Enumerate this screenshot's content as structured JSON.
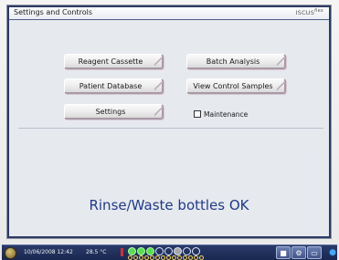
{
  "window": {
    "title": "Settings and Controls",
    "brand": "ISCUS",
    "brand_sup": "flex"
  },
  "buttons": {
    "reagent_cassette": "Reagent Cassette",
    "batch_analysis": "Batch Analysis",
    "patient_database": "Patient Database",
    "view_control_samples": "View Control Samples",
    "settings": "Settings"
  },
  "maintenance": {
    "label": "Maintenance",
    "checked": false
  },
  "status_message": "Rinse/Waste bottles OK",
  "taskbar": {
    "datetime": "10/06/2008 12:42",
    "temperature": "28.5 °C",
    "indicator_states": [
      "on",
      "on",
      "on",
      "off",
      "off",
      "gray",
      "off",
      "off"
    ],
    "icons": [
      "power-icon",
      "window-icon",
      "gear-icon",
      "folder-icon",
      "globe-icon"
    ]
  }
}
